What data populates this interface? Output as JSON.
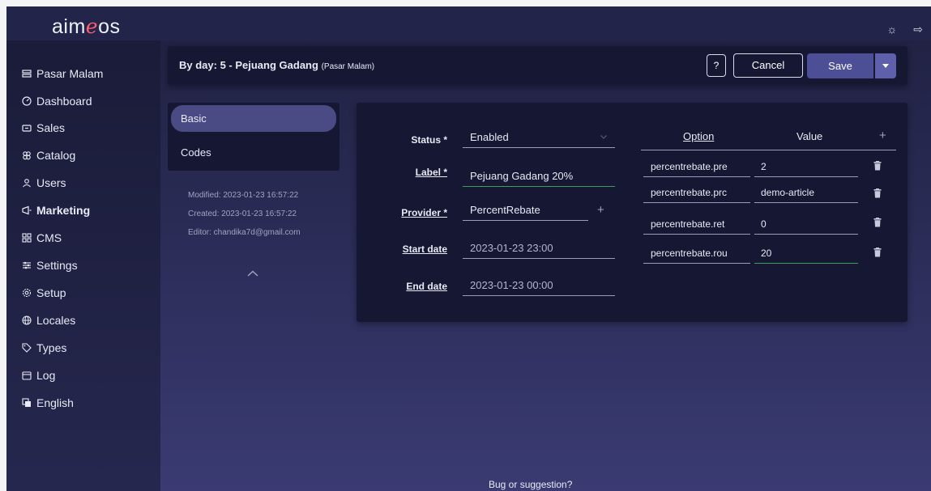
{
  "app": {
    "logo_prefix": "aim",
    "logo_e": "e",
    "logo_suffix": "os"
  },
  "topbar": {
    "theme_icon": "sun-icon",
    "logout_icon": "logout-icon"
  },
  "sidebar": {
    "items": [
      {
        "label": "Pasar Malam",
        "icon": "site-icon"
      },
      {
        "label": "Dashboard",
        "icon": "dashboard-icon"
      },
      {
        "label": "Sales",
        "icon": "sales-icon"
      },
      {
        "label": "Catalog",
        "icon": "catalog-icon"
      },
      {
        "label": "Users",
        "icon": "users-icon"
      },
      {
        "label": "Marketing",
        "icon": "marketing-icon",
        "active": true
      },
      {
        "label": "CMS",
        "icon": "cms-icon"
      },
      {
        "label": "Settings",
        "icon": "settings-icon"
      },
      {
        "label": "Setup",
        "icon": "setup-icon"
      },
      {
        "label": "Locales",
        "icon": "locales-icon"
      },
      {
        "label": "Types",
        "icon": "types-icon"
      },
      {
        "label": "Log",
        "icon": "log-icon"
      },
      {
        "label": "English",
        "icon": "language-icon"
      }
    ]
  },
  "header": {
    "title": "By day: 5 - Pejuang Gadang",
    "site": "(Pasar Malam)",
    "help_label": "?",
    "cancel_label": "Cancel",
    "save_label": "Save"
  },
  "tabs": [
    {
      "label": "Basic",
      "active": true
    },
    {
      "label": "Codes",
      "active": false
    }
  ],
  "meta": {
    "modified": "Modified: 2023-01-23 16:57:22",
    "created": "Created: 2023-01-23 16:57:22",
    "editor": "Editor: chandika7d@gmail.com"
  },
  "form": {
    "status": {
      "label": "Status *",
      "value": "Enabled"
    },
    "label": {
      "label": "Label *",
      "value": "Pejuang Gadang 20%"
    },
    "provider": {
      "label": "Provider *",
      "value": "PercentRebate"
    },
    "start_date": {
      "label": "Start date",
      "value": "2023-01-23 23:00"
    },
    "end_date": {
      "label": "End date",
      "value": "2023-01-23 00:00"
    }
  },
  "config": {
    "option_header": "Option",
    "value_header": "Value",
    "rows": [
      {
        "option": "percentrebate.pre",
        "value": "2"
      },
      {
        "option": "percentrebate.prc",
        "value": "demo-article"
      },
      {
        "option": "percentrebate.ret",
        "value": "0"
      },
      {
        "option": "percentrebate.rou",
        "value": "20"
      }
    ]
  },
  "footer": {
    "link": "Bug or suggestion?"
  },
  "colors": {
    "accent": "#4d4f96",
    "danger_logo": "#ff5f6d",
    "valid": "#3a9d5c"
  }
}
